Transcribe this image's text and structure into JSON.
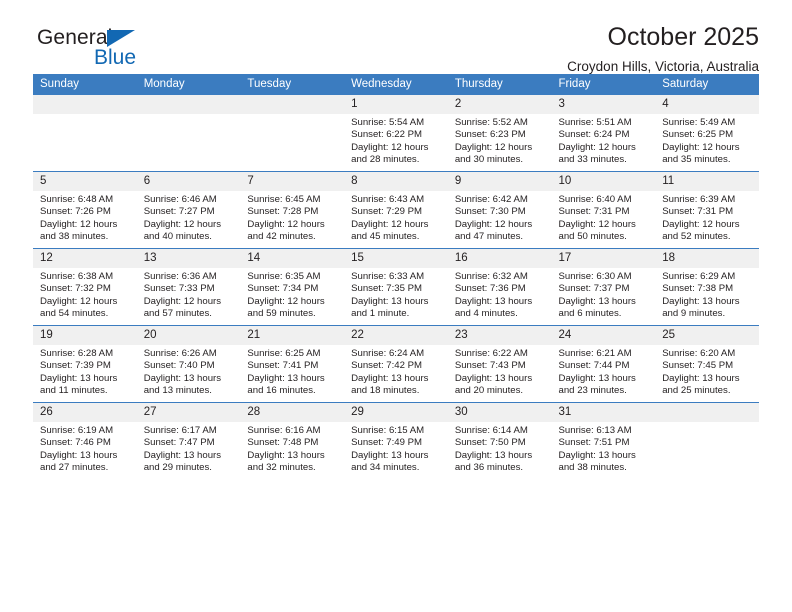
{
  "brand": {
    "name_top": "General",
    "name_bottom": "Blue",
    "accent_color": "#1268b3"
  },
  "header": {
    "title": "October 2025",
    "subtitle": "Croydon Hills, Victoria, Australia"
  },
  "calendar": {
    "header_bg": "#3b7cc0",
    "daynum_bg": "#f0f0f0",
    "weekdays": [
      "Sunday",
      "Monday",
      "Tuesday",
      "Wednesday",
      "Thursday",
      "Friday",
      "Saturday"
    ],
    "weeks": [
      [
        {
          "day": "",
          "lines": []
        },
        {
          "day": "",
          "lines": []
        },
        {
          "day": "",
          "lines": []
        },
        {
          "day": "1",
          "lines": [
            "Sunrise: 5:54 AM",
            "Sunset: 6:22 PM",
            "Daylight: 12 hours",
            "and 28 minutes."
          ]
        },
        {
          "day": "2",
          "lines": [
            "Sunrise: 5:52 AM",
            "Sunset: 6:23 PM",
            "Daylight: 12 hours",
            "and 30 minutes."
          ]
        },
        {
          "day": "3",
          "lines": [
            "Sunrise: 5:51 AM",
            "Sunset: 6:24 PM",
            "Daylight: 12 hours",
            "and 33 minutes."
          ]
        },
        {
          "day": "4",
          "lines": [
            "Sunrise: 5:49 AM",
            "Sunset: 6:25 PM",
            "Daylight: 12 hours",
            "and 35 minutes."
          ]
        }
      ],
      [
        {
          "day": "5",
          "lines": [
            "Sunrise: 6:48 AM",
            "Sunset: 7:26 PM",
            "Daylight: 12 hours",
            "and 38 minutes."
          ]
        },
        {
          "day": "6",
          "lines": [
            "Sunrise: 6:46 AM",
            "Sunset: 7:27 PM",
            "Daylight: 12 hours",
            "and 40 minutes."
          ]
        },
        {
          "day": "7",
          "lines": [
            "Sunrise: 6:45 AM",
            "Sunset: 7:28 PM",
            "Daylight: 12 hours",
            "and 42 minutes."
          ]
        },
        {
          "day": "8",
          "lines": [
            "Sunrise: 6:43 AM",
            "Sunset: 7:29 PM",
            "Daylight: 12 hours",
            "and 45 minutes."
          ]
        },
        {
          "day": "9",
          "lines": [
            "Sunrise: 6:42 AM",
            "Sunset: 7:30 PM",
            "Daylight: 12 hours",
            "and 47 minutes."
          ]
        },
        {
          "day": "10",
          "lines": [
            "Sunrise: 6:40 AM",
            "Sunset: 7:31 PM",
            "Daylight: 12 hours",
            "and 50 minutes."
          ]
        },
        {
          "day": "11",
          "lines": [
            "Sunrise: 6:39 AM",
            "Sunset: 7:31 PM",
            "Daylight: 12 hours",
            "and 52 minutes."
          ]
        }
      ],
      [
        {
          "day": "12",
          "lines": [
            "Sunrise: 6:38 AM",
            "Sunset: 7:32 PM",
            "Daylight: 12 hours",
            "and 54 minutes."
          ]
        },
        {
          "day": "13",
          "lines": [
            "Sunrise: 6:36 AM",
            "Sunset: 7:33 PM",
            "Daylight: 12 hours",
            "and 57 minutes."
          ]
        },
        {
          "day": "14",
          "lines": [
            "Sunrise: 6:35 AM",
            "Sunset: 7:34 PM",
            "Daylight: 12 hours",
            "and 59 minutes."
          ]
        },
        {
          "day": "15",
          "lines": [
            "Sunrise: 6:33 AM",
            "Sunset: 7:35 PM",
            "Daylight: 13 hours",
            "and 1 minute."
          ]
        },
        {
          "day": "16",
          "lines": [
            "Sunrise: 6:32 AM",
            "Sunset: 7:36 PM",
            "Daylight: 13 hours",
            "and 4 minutes."
          ]
        },
        {
          "day": "17",
          "lines": [
            "Sunrise: 6:30 AM",
            "Sunset: 7:37 PM",
            "Daylight: 13 hours",
            "and 6 minutes."
          ]
        },
        {
          "day": "18",
          "lines": [
            "Sunrise: 6:29 AM",
            "Sunset: 7:38 PM",
            "Daylight: 13 hours",
            "and 9 minutes."
          ]
        }
      ],
      [
        {
          "day": "19",
          "lines": [
            "Sunrise: 6:28 AM",
            "Sunset: 7:39 PM",
            "Daylight: 13 hours",
            "and 11 minutes."
          ]
        },
        {
          "day": "20",
          "lines": [
            "Sunrise: 6:26 AM",
            "Sunset: 7:40 PM",
            "Daylight: 13 hours",
            "and 13 minutes."
          ]
        },
        {
          "day": "21",
          "lines": [
            "Sunrise: 6:25 AM",
            "Sunset: 7:41 PM",
            "Daylight: 13 hours",
            "and 16 minutes."
          ]
        },
        {
          "day": "22",
          "lines": [
            "Sunrise: 6:24 AM",
            "Sunset: 7:42 PM",
            "Daylight: 13 hours",
            "and 18 minutes."
          ]
        },
        {
          "day": "23",
          "lines": [
            "Sunrise: 6:22 AM",
            "Sunset: 7:43 PM",
            "Daylight: 13 hours",
            "and 20 minutes."
          ]
        },
        {
          "day": "24",
          "lines": [
            "Sunrise: 6:21 AM",
            "Sunset: 7:44 PM",
            "Daylight: 13 hours",
            "and 23 minutes."
          ]
        },
        {
          "day": "25",
          "lines": [
            "Sunrise: 6:20 AM",
            "Sunset: 7:45 PM",
            "Daylight: 13 hours",
            "and 25 minutes."
          ]
        }
      ],
      [
        {
          "day": "26",
          "lines": [
            "Sunrise: 6:19 AM",
            "Sunset: 7:46 PM",
            "Daylight: 13 hours",
            "and 27 minutes."
          ]
        },
        {
          "day": "27",
          "lines": [
            "Sunrise: 6:17 AM",
            "Sunset: 7:47 PM",
            "Daylight: 13 hours",
            "and 29 minutes."
          ]
        },
        {
          "day": "28",
          "lines": [
            "Sunrise: 6:16 AM",
            "Sunset: 7:48 PM",
            "Daylight: 13 hours",
            "and 32 minutes."
          ]
        },
        {
          "day": "29",
          "lines": [
            "Sunrise: 6:15 AM",
            "Sunset: 7:49 PM",
            "Daylight: 13 hours",
            "and 34 minutes."
          ]
        },
        {
          "day": "30",
          "lines": [
            "Sunrise: 6:14 AM",
            "Sunset: 7:50 PM",
            "Daylight: 13 hours",
            "and 36 minutes."
          ]
        },
        {
          "day": "31",
          "lines": [
            "Sunrise: 6:13 AM",
            "Sunset: 7:51 PM",
            "Daylight: 13 hours",
            "and 38 minutes."
          ]
        },
        {
          "day": "",
          "lines": []
        }
      ]
    ]
  }
}
